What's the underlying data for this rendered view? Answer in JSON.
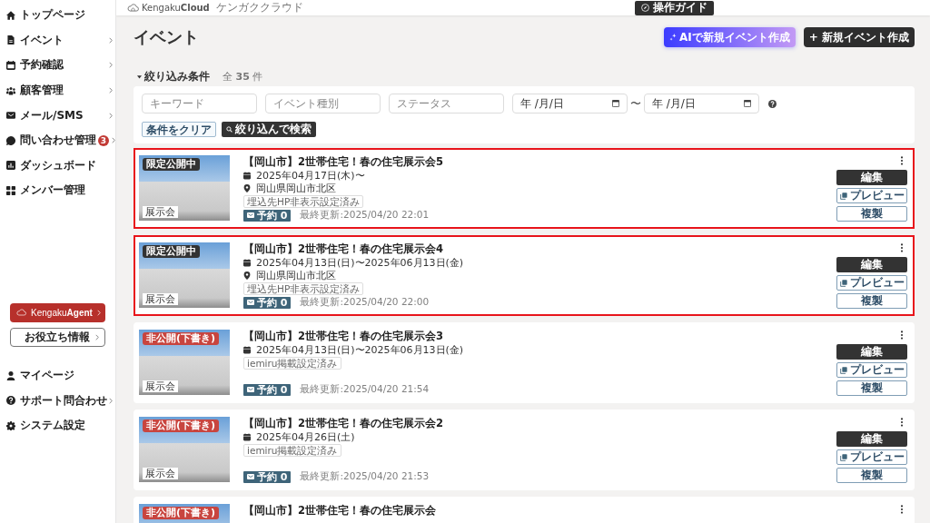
{
  "header": {
    "logo": "Kengaku**Cloud**",
    "logo_subtitle": "ケンガククラウド",
    "guide_button": "操作ガイド"
  },
  "sidebar": {
    "nav": [
      {
        "label": "トップページ",
        "submenu": false,
        "selected": false
      },
      {
        "label": "イベント",
        "submenu": true,
        "selected": false
      },
      {
        "label": "予約確認",
        "submenu": true,
        "selected": false
      },
      {
        "label": "顧客管理",
        "submenu": true,
        "selected": false
      },
      {
        "label": "メール/SMS",
        "submenu": true,
        "selected": false
      },
      {
        "label": "問い合わせ管理",
        "submenu": true,
        "selected": false,
        "badge": "3"
      },
      {
        "label": "ダッシュボード",
        "submenu": false,
        "selected": false
      },
      {
        "label": "メンバー管理",
        "submenu": false,
        "selected": false
      }
    ],
    "agent_button": "Kengaku**Agent**",
    "info_button": "お役立ち情報",
    "footer_nav": [
      {
        "label": "マイページ",
        "submenu": false,
        "selected": false
      },
      {
        "label": "サポート問合わせ",
        "submenu": true,
        "selected": false
      },
      {
        "label": "システム設定",
        "submenu": false,
        "selected": false
      }
    ]
  },
  "page": {
    "title": "イベント",
    "ai_button": "AIで新規イベント作成",
    "new_button": "+ 新規イベント作成"
  },
  "filter": {
    "toggle": "絞り込み条件",
    "expanded": true,
    "count": "全 **35** 件",
    "keyword": {
      "placeholder": "キーワード"
    },
    "event_type": {
      "placeholder": "イベント種別"
    },
    "status": {
      "placeholder": "ステータス"
    },
    "date_from": {
      "placeholder": "年 /月/日"
    },
    "range_separator": "〜",
    "date_to": {
      "placeholder": "年 /月/日"
    },
    "clear_button": "条件をクリア",
    "search_button": "絞り込んで検索"
  },
  "events": [
    {
      "title": "【岡山市】2世帯住宅！春の住宅展示会5",
      "status": {
        "label": "限定公開中",
        "kind": "limited"
      },
      "category": "展示会",
      "date": "2025年04月17日(木)〜",
      "location": "岡山県岡山市北区",
      "tag": "埋込先HP非表示設定済み",
      "reservations": "予約 0",
      "updated": "最終更新:2025/04/20 22:01",
      "highlighted": true,
      "buttons": [
        {
          "label": "編集",
          "kind": "primary"
        },
        {
          "label": "プレビュー",
          "kind": "preview"
        },
        {
          "label": "複製",
          "kind": "plain"
        }
      ]
    },
    {
      "title": "【岡山市】2世帯住宅！春の住宅展示会4",
      "status": {
        "label": "限定公開中",
        "kind": "limited"
      },
      "category": "展示会",
      "date": "2025年04月13日(日)〜2025年06月13日(金)",
      "location": "岡山県岡山市北区",
      "tag": "埋込先HP非表示設定済み",
      "reservations": "予約 0",
      "updated": "最終更新:2025/04/20 22:00",
      "highlighted": true,
      "buttons": [
        {
          "label": "編集",
          "kind": "primary"
        },
        {
          "label": "プレビュー",
          "kind": "preview"
        },
        {
          "label": "複製",
          "kind": "plain"
        }
      ]
    },
    {
      "title": "【岡山市】2世帯住宅！春の住宅展示会3",
      "status": {
        "label": "非公開(下書き)",
        "kind": "draft"
      },
      "category": "展示会",
      "date": "2025年04月13日(日)〜2025年06月13日(金)",
      "tag": "iemiru掲載設定済み",
      "reservations": "予約 0",
      "updated": "最終更新:2025/04/20 21:54",
      "highlighted": false,
      "buttons": [
        {
          "label": "編集",
          "kind": "primary"
        },
        {
          "label": "プレビュー",
          "kind": "preview"
        },
        {
          "label": "複製",
          "kind": "plain"
        }
      ]
    },
    {
      "title": "【岡山市】2世帯住宅！春の住宅展示会2",
      "status": {
        "label": "非公開(下書き)",
        "kind": "draft"
      },
      "category": "展示会",
      "date": "2025年04月26日(土)",
      "tag": "iemiru掲載設定済み",
      "reservations": "予約 0",
      "updated": "最終更新:2025/04/20 21:53",
      "highlighted": false,
      "buttons": [
        {
          "label": "編集",
          "kind": "primary"
        },
        {
          "label": "プレビュー",
          "kind": "preview"
        },
        {
          "label": "複製",
          "kind": "plain"
        }
      ]
    },
    {
      "title": "【岡山市】2世帯住宅！春の住宅展示会",
      "status": {
        "label": "非公開(下書き)",
        "kind": "draft"
      },
      "highlighted": false
    }
  ]
}
